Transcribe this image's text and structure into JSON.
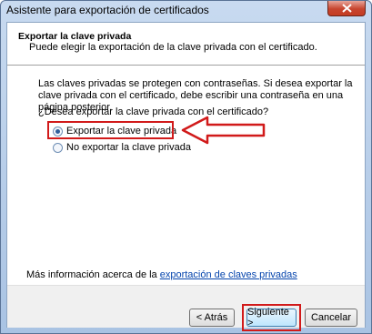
{
  "window": {
    "title": "Asistente para exportación de certificados"
  },
  "header": {
    "title": "Exportar la clave privada",
    "subtitle": "Puede elegir la exportación de la clave privada con el certificado."
  },
  "body": {
    "info": "Las claves privadas se protegen con contraseñas. Si desea exportar la clave privada con el certificado, debe escribir una contraseña en una página posterior.",
    "question": "¿Desea exportar la clave privada con el certificado?",
    "options": [
      {
        "label": "Exportar la clave privada",
        "checked": true
      },
      {
        "label": "No exportar la clave privada",
        "checked": false
      }
    ],
    "more_info_prefix": "Más información acerca de la ",
    "more_info_link": "exportación de claves privadas"
  },
  "footer": {
    "back_label": "< Atrás",
    "next_label": "Siguiente >",
    "cancel_label": "Cancelar"
  },
  "colors": {
    "annotation": "#d11a1a",
    "link": "#0645ad"
  }
}
